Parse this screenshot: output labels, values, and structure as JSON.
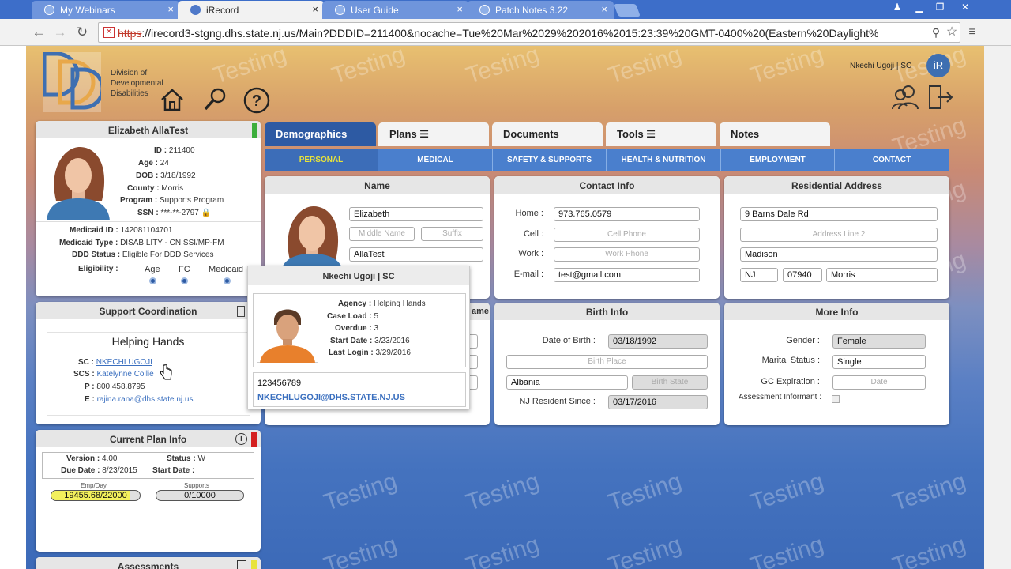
{
  "browser": {
    "tabs": [
      {
        "label": "My Webinars",
        "active": false
      },
      {
        "label": "iRecord",
        "active": true
      },
      {
        "label": "User Guide",
        "active": false
      },
      {
        "label": "Patch Notes 3.22",
        "active": false
      }
    ],
    "url_scheme": "https",
    "url_rest": "://irecord3-stgng.dhs.state.nj.us/Main?DDDID=211400&nocache=Tue%20Mar%2029%202016%2015:23:39%20GMT-0400%20(Eastern%20Daylight%"
  },
  "header": {
    "logo_text": "Division of Developmental Disabilities",
    "logo_line1": "Division of",
    "logo_line2": "Developmental",
    "logo_line3": "Disabilities",
    "user": "Nkechi Ugoji | SC",
    "user_initials": "iR",
    "watermark": "Testing"
  },
  "person": {
    "name": "Elizabeth AllaTest",
    "id_label": "ID :",
    "id": "211400",
    "age_label": "Age :",
    "age": "24",
    "dob_label": "DOB :",
    "dob": "3/18/1992",
    "county_label": "County :",
    "county": "Morris",
    "program_label": "Program :",
    "program": "Supports Program",
    "ssn_label": "SSN :",
    "ssn": "***-**-2797",
    "medicaid_id_label": "Medicaid ID :",
    "medicaid_id": "142081104701",
    "medicaid_type_label": "Medicaid Type :",
    "medicaid_type": "DISABILITY - CN SSI/MP-FM",
    "ddd_status_label": "DDD Status :",
    "ddd_status": "Eligible For DDD Services",
    "eligibility_label": "Eligibility :",
    "eligibility_cols": [
      "Age",
      "FC",
      "Medicaid"
    ]
  },
  "support": {
    "title": "Support Coordination",
    "agency": "Helping Hands",
    "sc_label": "SC :",
    "sc": "NKECHI UGOJI",
    "scs_label": "SCS :",
    "scs": "Katelynne Collie",
    "p_label": "P :",
    "phone": "800.458.8795",
    "e_label": "E :",
    "email": "rajina.rana@dhs.state.nj.us"
  },
  "plan": {
    "title": "Current Plan Info",
    "version_label": "Version :",
    "version": "4.00",
    "status_label": "Status :",
    "status": "W",
    "due_label": "Due Date :",
    "due": "8/23/2015",
    "start_label": "Start Date :",
    "start": "",
    "emp_label": "Emp/Day",
    "emp_value": "19455.68/22000",
    "emp_fraction": 0.88,
    "supports_label": "Supports",
    "supports_value": "0/10000",
    "supports_fraction": 0.0
  },
  "assessments": {
    "title": "Assessments"
  },
  "main_tabs": [
    {
      "label": "Demographics",
      "active": true
    },
    {
      "label": "Plans ☰",
      "active": false
    },
    {
      "label": "Documents",
      "active": false
    },
    {
      "label": "Tools ☰",
      "active": false
    },
    {
      "label": "Notes",
      "active": false
    }
  ],
  "sub_tabs": [
    {
      "label": "PERSONAL",
      "active": true
    },
    {
      "label": "MEDICAL",
      "active": false
    },
    {
      "label": "SAFETY & SUPPORTS",
      "active": false
    },
    {
      "label": "HEALTH & NUTRITION",
      "active": false
    },
    {
      "label": "EMPLOYMENT",
      "active": false
    },
    {
      "label": "CONTACT",
      "active": false
    }
  ],
  "name_panel": {
    "title": "Name",
    "first": "Elizabeth",
    "middle_ph": "Middle Name",
    "suffix_ph": "Suffix",
    "last": "AllaTest"
  },
  "contact_panel": {
    "title": "Contact Info",
    "home_label": "Home :",
    "home": "973.765.0579",
    "cell_label": "Cell :",
    "cell_ph": "Cell Phone",
    "work_label": "Work :",
    "work_ph": "Work Phone",
    "email_label": "E-mail :",
    "email": "test@gmail.com"
  },
  "address_panel": {
    "title": "Residential Address",
    "line1": "9 Barns Dale Rd",
    "line2_ph": "Address Line 2",
    "city": "Madison",
    "state": "NJ",
    "zip": "07940",
    "county": "Morris"
  },
  "birth_panel": {
    "title": "Birth Info",
    "dob_label": "Date of Birth :",
    "dob": "03/18/1992",
    "place_ph": "Birth Place",
    "country": "Albania",
    "state_ph": "Birth State",
    "resident_label": "NJ Resident Since :",
    "resident": "03/17/2016"
  },
  "more_panel": {
    "title": "More Info",
    "gender_label": "Gender :",
    "gender": "Female",
    "marital_label": "Marital Status :",
    "marital": "Single",
    "gc_label": "GC Expiration :",
    "gc_ph": "Date",
    "informant_label": "Assessment Informant :"
  },
  "popup": {
    "title": "Nkechi Ugoji | SC",
    "agency_label": "Agency :",
    "agency": "Helping Hands",
    "caseload_label": "Case Load :",
    "caseload": "5",
    "overdue_label": "Overdue :",
    "overdue": "3",
    "start_label": "Start Date :",
    "start": "3/23/2016",
    "login_label": "Last Login :",
    "login": "3/29/2016",
    "phone": "123456789",
    "email": "NKECHLUGOJI@DHS.STATE.NJ.US",
    "behind_text": "ame"
  },
  "colors": {
    "accent": "#2d5aa3",
    "subbar": "#4a7fcd",
    "active_sub_text": "#e8e33a",
    "status_green": "#3cae3c",
    "status_red": "#d42020"
  }
}
